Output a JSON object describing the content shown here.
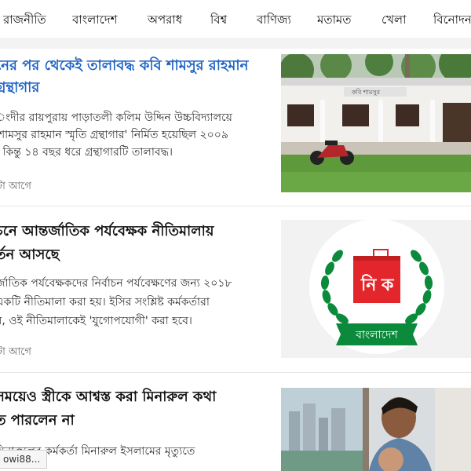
{
  "nav": {
    "items": [
      {
        "label": "রাজনীতি"
      },
      {
        "label": "বাংলাদেশ"
      },
      {
        "label": "অপরাধ"
      },
      {
        "label": "বিশ্ব"
      },
      {
        "label": "বাণিজ্য"
      },
      {
        "label": "মতামত"
      },
      {
        "label": "খেলা"
      },
      {
        "label": "বিনোদন"
      }
    ]
  },
  "articles": [
    {
      "headline_lines": [
        "নের পর থেকেই তালাবদ্ধ কবি শামসুর রাহমান",
        "গ্রন্থাগার"
      ],
      "summary_lines": [
        "ংদীর রায়পুরায় পাড়াতলী কলিম উদ্দিন উচ্চবিদ্যালয়ে",
        "'শামসুর রাহমান স্মৃতি গ্রন্থাগার' নির্মিত হয়েছিল ২০০৯",
        "। কিন্তু ১৪ বছর ধরে গ্রন্থাগারটি তালাবদ্ধ।"
      ],
      "timestamp": "টা আগে",
      "image": "building-photo"
    },
    {
      "headline_lines": [
        "চনে আন্তর্জাতিক পর্যবেক্ষক নীতিমালায়",
        "র্তন আসছে"
      ],
      "summary_lines": [
        "র্জাতিক পর্যবেক্ষকদের নির্বাচন পর্যবেক্ষণের জন্য ২০১৮",
        "একটি নীতিমালা করা হয়। ইসির সংশ্লিষ্ট কর্মকর্তারা",
        "ন, ওই নীতিমালাকেই 'যুগোপযোগী' করা হবে।"
      ],
      "timestamp": "টা আগে",
      "image": "election-commission-logo",
      "logo_text": {
        "left": "নি",
        "right": "ক",
        "banner": "বাংলাদেশ"
      }
    },
    {
      "headline_lines": [
        "সময়েও স্ত্রীকে আশ্বস্ত করা মিনারুল কথা",
        "ত পারলেন না"
      ],
      "summary_lines": [
        "মিনারুলের কর্মকর্তা মিনারুল ইসলামের মৃত্যুতে"
      ],
      "image": "man-by-window-photo"
    }
  ],
  "status_bar": {
    "text": "owi88..."
  },
  "colors": {
    "headline_link": "#1e63c5",
    "logo_green": "#0a8a3a",
    "logo_red": "#e3262b"
  }
}
